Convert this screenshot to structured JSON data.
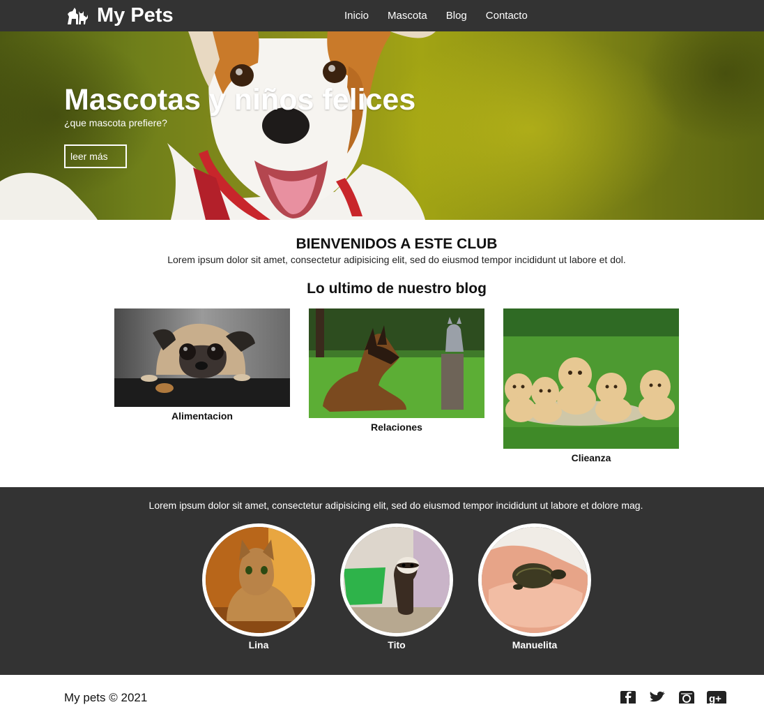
{
  "header": {
    "title": "My Pets",
    "logo_icon": "pets-icon",
    "nav": [
      {
        "label": "Inicio"
      },
      {
        "label": "Mascota"
      },
      {
        "label": "Blog"
      },
      {
        "label": "Contacto"
      }
    ]
  },
  "hero": {
    "title": "Mascotas y niños felices",
    "subtitle": "¿que mascota prefiere?",
    "button_label": "leer más"
  },
  "welcome": {
    "title": "BIENVENIDOS A ESTE CLUB",
    "text": "Lorem ipsum dolor sit amet, consectetur adipisicing elit, sed do eiusmod tempor incididunt ut labore et dol."
  },
  "blog": {
    "title": "Lo ultimo de nuestro blog",
    "posts": [
      {
        "caption": "Alimentacion"
      },
      {
        "caption": "Relaciones"
      },
      {
        "caption": "Clieanza"
      }
    ]
  },
  "band": {
    "text": "Lorem ipsum dolor sit amet, consectetur adipisicing elit, sed do eiusmod tempor incididunt ut labore et dolore mag.",
    "pets": [
      {
        "name": "Lina"
      },
      {
        "name": "Tito"
      },
      {
        "name": "Manuelita"
      }
    ]
  },
  "footer": {
    "copyright": "My pets © 2021",
    "social_icons": [
      "facebook-icon",
      "twitter-icon",
      "instagram-icon",
      "google-plus-icon"
    ]
  },
  "colors": {
    "bar": "#333333",
    "text_light": "#ffffff"
  }
}
